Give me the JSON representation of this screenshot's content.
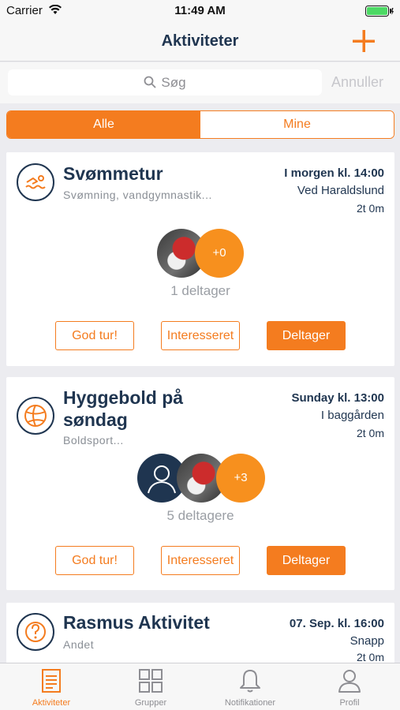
{
  "status_bar": {
    "carrier": "Carrier",
    "time": "11:49 AM"
  },
  "nav": {
    "title": "Aktiviteter",
    "add_icon": "plus-icon"
  },
  "search": {
    "placeholder": "Søg",
    "cancel_label": "Annuller"
  },
  "segments": [
    {
      "label": "Alle",
      "selected": true
    },
    {
      "label": "Mine",
      "selected": false
    }
  ],
  "activities": [
    {
      "icon": "swimmer-icon",
      "title": "Svømmetur",
      "subtitle": "Svømning, vandgymnastik...",
      "when": "I morgen kl. 14:00",
      "where": "Ved Haraldslund",
      "duration": "2t 0m",
      "extra_count": "+0",
      "participants": "1 deltager",
      "buttons": {
        "good_trip": "God tur!",
        "interested": "Interesseret",
        "join": "Deltager"
      }
    },
    {
      "icon": "volleyball-icon",
      "title_line1": "Hyggebold på",
      "title_line2": "søndag",
      "subtitle": "Boldsport...",
      "when": "Sunday kl. 13:00",
      "where": "I baggården",
      "duration": "2t 0m",
      "extra_count": "+3",
      "participants": "5 deltagere",
      "buttons": {
        "good_trip": "God tur!",
        "interested": "Interesseret",
        "join": "Deltager"
      }
    },
    {
      "icon": "question-icon",
      "title": "Rasmus Aktivitet",
      "subtitle": "Andet",
      "when": "07. Sep. kl. 16:00",
      "where": "Snapp",
      "duration": "2t 0m"
    }
  ],
  "tabs": [
    {
      "label": "Aktiviteter",
      "icon": "document-icon",
      "active": true
    },
    {
      "label": "Grupper",
      "icon": "grid-icon",
      "active": false
    },
    {
      "label": "Notifikationer",
      "icon": "bell-icon",
      "active": false
    },
    {
      "label": "Profil",
      "icon": "person-icon",
      "active": false
    }
  ],
  "colors": {
    "accent": "#f47c1f",
    "navy": "#1f3550",
    "avatar_count_bg": "#f7901e"
  }
}
